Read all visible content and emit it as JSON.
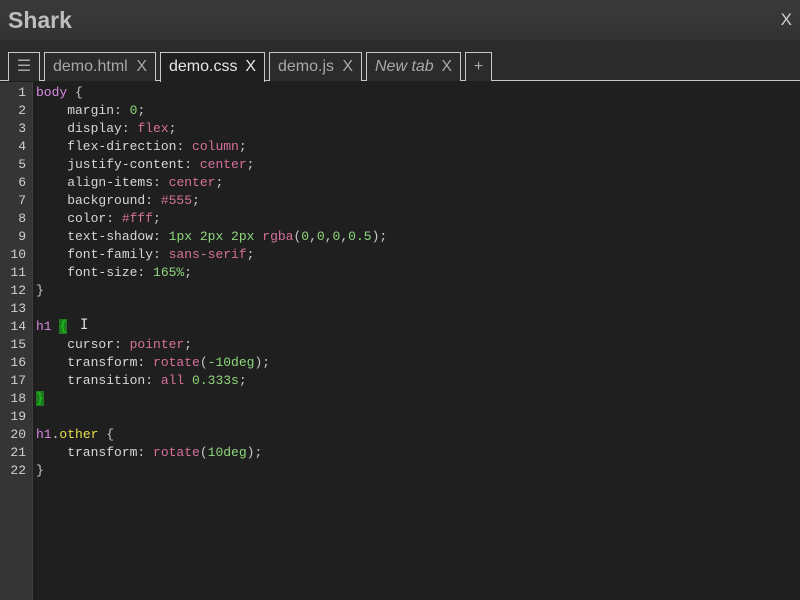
{
  "app": {
    "title": "Shark",
    "close_label": "X"
  },
  "tabs": {
    "menu_label": "☰",
    "add_label": "+",
    "items": [
      {
        "label": "demo.html",
        "close": "X",
        "active": false,
        "italic": false
      },
      {
        "label": "demo.css",
        "close": "X",
        "active": true,
        "italic": false
      },
      {
        "label": "demo.js",
        "close": "X",
        "active": false,
        "italic": false
      },
      {
        "label": "New tab",
        "close": "X",
        "active": false,
        "italic": true
      }
    ]
  },
  "colors": {
    "selector": "#d88ae0",
    "property": "#d6d6d6",
    "keyword": "#d6709a",
    "number": "#8fd77c",
    "string_func": "#d6709a",
    "punct": "#c8c8c8",
    "class_name": "#e6e04a",
    "bracket_match_bg": "#1e7a1e",
    "bracket_match_fg": "#1fd01f"
  },
  "editor": {
    "lines": [
      {
        "n": "1",
        "tokens": [
          [
            "sel",
            "body"
          ],
          [
            "p",
            " {"
          ]
        ]
      },
      {
        "n": "2",
        "tokens": [
          [
            "prop",
            "    margin"
          ],
          [
            "p",
            ": "
          ],
          [
            "num",
            "0"
          ],
          [
            "p",
            ";"
          ]
        ]
      },
      {
        "n": "3",
        "tokens": [
          [
            "prop",
            "    display"
          ],
          [
            "p",
            ": "
          ],
          [
            "kw",
            "flex"
          ],
          [
            "p",
            ";"
          ]
        ]
      },
      {
        "n": "4",
        "tokens": [
          [
            "prop",
            "    flex-direction"
          ],
          [
            "p",
            ": "
          ],
          [
            "kw",
            "column"
          ],
          [
            "p",
            ";"
          ]
        ]
      },
      {
        "n": "5",
        "tokens": [
          [
            "prop",
            "    justify-content"
          ],
          [
            "p",
            ": "
          ],
          [
            "kw",
            "center"
          ],
          [
            "p",
            ";"
          ]
        ]
      },
      {
        "n": "6",
        "tokens": [
          [
            "prop",
            "    align-items"
          ],
          [
            "p",
            ": "
          ],
          [
            "kw",
            "center"
          ],
          [
            "p",
            ";"
          ]
        ]
      },
      {
        "n": "7",
        "tokens": [
          [
            "prop",
            "    background"
          ],
          [
            "p",
            ": "
          ],
          [
            "kw",
            "#555"
          ],
          [
            "p",
            ";"
          ]
        ]
      },
      {
        "n": "8",
        "tokens": [
          [
            "prop",
            "    color"
          ],
          [
            "p",
            ": "
          ],
          [
            "kw",
            "#fff"
          ],
          [
            "p",
            ";"
          ]
        ]
      },
      {
        "n": "9",
        "tokens": [
          [
            "prop",
            "    text-shadow"
          ],
          [
            "p",
            ": "
          ],
          [
            "num",
            "1px 2px 2px "
          ],
          [
            "kw",
            "rgba"
          ],
          [
            "p",
            "("
          ],
          [
            "num",
            "0"
          ],
          [
            "p",
            ","
          ],
          [
            "num",
            "0"
          ],
          [
            "p",
            ","
          ],
          [
            "num",
            "0"
          ],
          [
            "p",
            ","
          ],
          [
            "num",
            "0.5"
          ],
          [
            "p",
            ");"
          ]
        ]
      },
      {
        "n": "10",
        "tokens": [
          [
            "prop",
            "    font-family"
          ],
          [
            "p",
            ": "
          ],
          [
            "kw",
            "sans-serif"
          ],
          [
            "p",
            ";"
          ]
        ]
      },
      {
        "n": "11",
        "tokens": [
          [
            "prop",
            "    font-size"
          ],
          [
            "p",
            ": "
          ],
          [
            "num",
            "165%"
          ],
          [
            "p",
            ";"
          ]
        ]
      },
      {
        "n": "12",
        "tokens": [
          [
            "p",
            "}"
          ]
        ]
      },
      {
        "n": "13",
        "tokens": []
      },
      {
        "n": "14",
        "tokens": [
          [
            "sel",
            "h1"
          ],
          [
            "p",
            " "
          ],
          [
            "match",
            "{"
          ]
        ]
      },
      {
        "n": "15",
        "tokens": [
          [
            "prop",
            "    cursor"
          ],
          [
            "p",
            ": "
          ],
          [
            "kw",
            "pointer"
          ],
          [
            "p",
            ";"
          ]
        ]
      },
      {
        "n": "16",
        "tokens": [
          [
            "prop",
            "    transform"
          ],
          [
            "p",
            ": "
          ],
          [
            "kw",
            "rotate"
          ],
          [
            "p",
            "("
          ],
          [
            "num",
            "-10deg"
          ],
          [
            "p",
            ");"
          ]
        ]
      },
      {
        "n": "17",
        "tokens": [
          [
            "prop",
            "    transition"
          ],
          [
            "p",
            ": "
          ],
          [
            "kw",
            "all"
          ],
          [
            "p",
            " "
          ],
          [
            "num",
            "0.333s"
          ],
          [
            "p",
            ";"
          ]
        ]
      },
      {
        "n": "18",
        "tokens": [
          [
            "match",
            "}"
          ]
        ]
      },
      {
        "n": "19",
        "tokens": []
      },
      {
        "n": "20",
        "tokens": [
          [
            "sel",
            "h1"
          ],
          [
            "p",
            "."
          ],
          [
            "cls",
            "other"
          ],
          [
            "p",
            " {"
          ]
        ]
      },
      {
        "n": "21",
        "tokens": [
          [
            "prop",
            "    transform"
          ],
          [
            "p",
            ": "
          ],
          [
            "kw",
            "rotate"
          ],
          [
            "p",
            "("
          ],
          [
            "num",
            "10deg"
          ],
          [
            "p",
            ");"
          ]
        ]
      },
      {
        "n": "22",
        "tokens": [
          [
            "p",
            "}"
          ]
        ]
      }
    ]
  },
  "cursor": {
    "glyph": "I",
    "icon": "text-cursor-icon"
  }
}
